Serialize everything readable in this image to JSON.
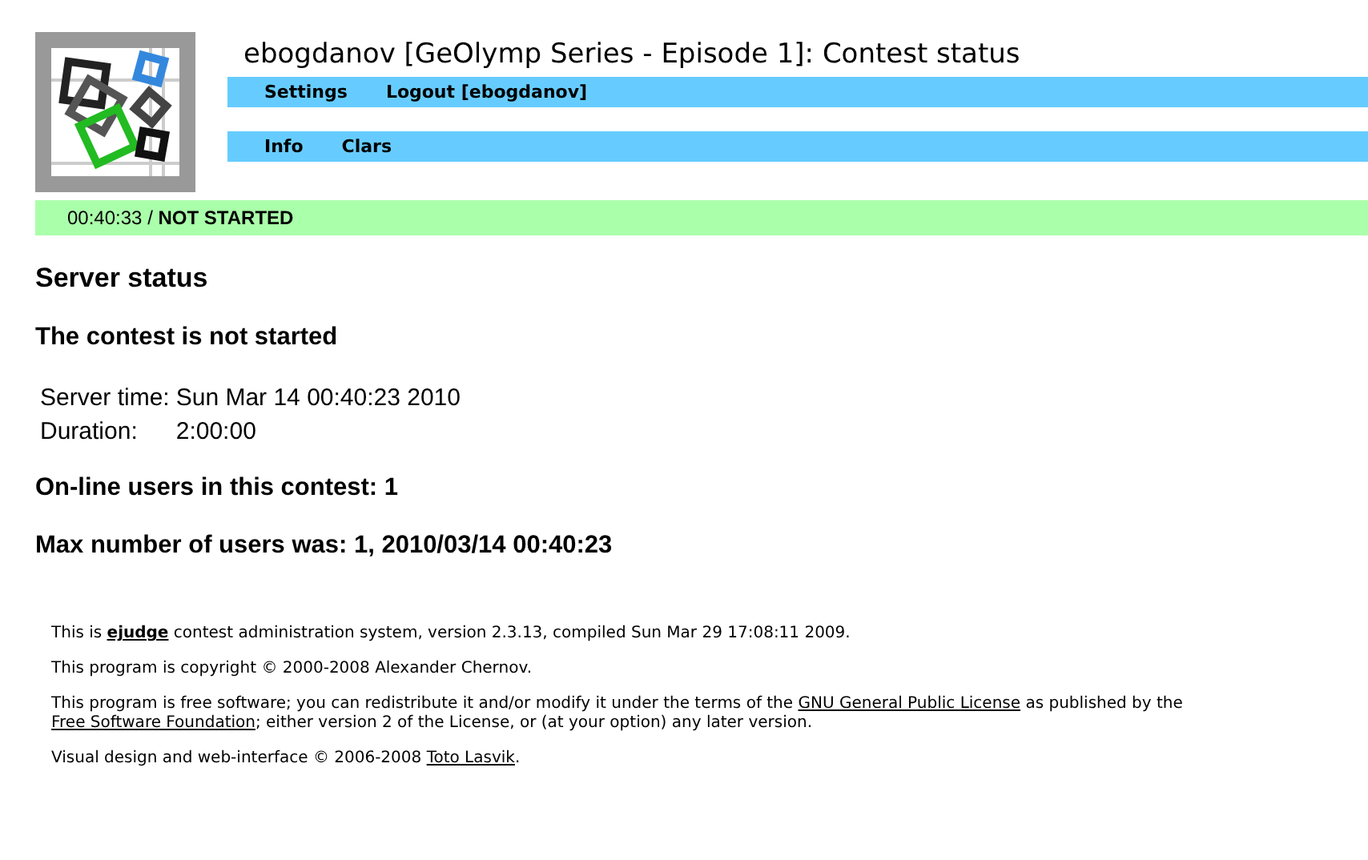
{
  "title": "ebogdanov [GeOlymp Series - Episode 1]: Contest status",
  "menus": [
    [
      {
        "label": "Settings"
      },
      {
        "label": "Logout [ebogdanov]"
      }
    ],
    [
      {
        "label": "Info"
      },
      {
        "label": "Clars"
      }
    ]
  ],
  "status_bar": {
    "time": "00:40:33",
    "separator": "/",
    "state": "NOT STARTED"
  },
  "heading": "Server status",
  "subheading": "The contest is not started",
  "info_rows": [
    {
      "label": "Server time:",
      "value": "Sun Mar 14 00:40:23 2010"
    },
    {
      "label": "Duration:",
      "value": "2:00:00"
    }
  ],
  "stats": [
    "On-line users in this contest: 1",
    "Max number of users was: 1, 2010/03/14 00:40:23"
  ],
  "footer": [
    [
      {
        "kind": "text",
        "text": "This is "
      },
      {
        "kind": "bold_link",
        "text": "ejudge"
      },
      {
        "kind": "text",
        "text": " contest administration system, version 2.3.13, compiled Sun Mar 29 17:08:11 2009."
      }
    ],
    [
      {
        "kind": "text",
        "text": "This program is copyright © 2000-2008 Alexander Chernov."
      }
    ],
    [
      {
        "kind": "text",
        "text": "This program is free software; you can redistribute it and/or modify it under the terms of the "
      },
      {
        "kind": "link",
        "text": "GNU General Public License"
      },
      {
        "kind": "text",
        "text": " as published by the "
      },
      {
        "kind": "link",
        "text": "Free Software Foundation"
      },
      {
        "kind": "text",
        "text": "; either version 2 of the License, or (at your option) any later version."
      }
    ],
    [
      {
        "kind": "text",
        "text": "Visual design and web-interface © 2006-2008 "
      },
      {
        "kind": "link",
        "text": "Toto Lasvik"
      },
      {
        "kind": "text",
        "text": "."
      }
    ]
  ]
}
